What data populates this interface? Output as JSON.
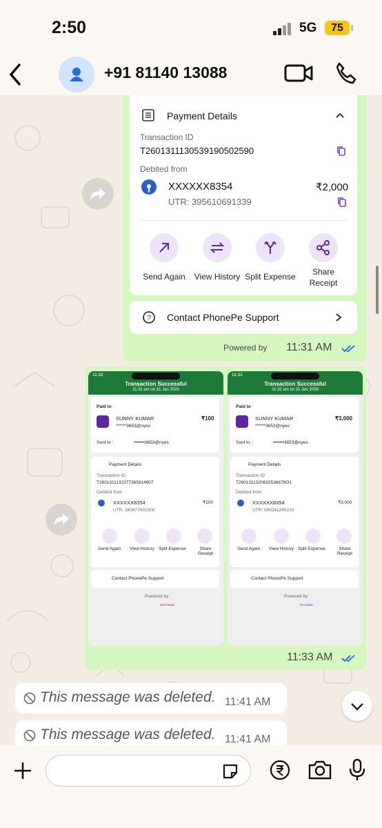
{
  "status": {
    "time": "2:50",
    "network": "5G",
    "battery": "75"
  },
  "chat": {
    "contact": "+91 81140 13088"
  },
  "msg1": {
    "section_title": "Payment Details",
    "txn_label": "Transaction ID",
    "txn_id": "T2601311130539190502590",
    "debited_label": "Debited from",
    "account": "XXXXXX8354",
    "amount": "₹2,000",
    "utr": "UTR: 395610691339",
    "actions": [
      "Send Again",
      "View History",
      "Split Expense",
      "Share\nReceipt"
    ],
    "support": "Contact PhonePe Support",
    "powered": "Powered by",
    "time": "11:31 AM"
  },
  "msg2": {
    "time": "11:33 AM",
    "shots": [
      {
        "clock": "11:32",
        "title": "Transaction Successful",
        "subtitle": "11:32 am on 31 Jan 2026",
        "paid_to": "Paid to",
        "name": "SUNNY KUMAR",
        "amount": "₹100",
        "upi": "******3653@nyes",
        "sent_to": "Sent to :",
        "sent_upi": "•••••••3653@nyes",
        "section": "Payment Details",
        "txn_label": "Transaction ID",
        "txn_id": "T2601311132377365914907",
        "debited": "Debited from",
        "account": "XXXXXX8354",
        "acct_amount": "₹100",
        "utr": "UTR: 360877650306",
        "actions": [
          "Send Again",
          "View History",
          "Split Expense",
          "Share Receipt"
        ],
        "support": "Contact PhonePe Support",
        "powered": "Powered by",
        "bank": "AXIS BANK"
      },
      {
        "clock": "11:32",
        "title": "Transaction Successful",
        "subtitle": "11:32 am on 31 Jan 2026",
        "paid_to": "Paid to",
        "name": "SUNNY KUMAR",
        "amount": "₹3,000",
        "upi": "******3653@nyes",
        "sent_to": "Sent to :",
        "sent_upi": "•••••••3653@nyes",
        "section": "Payment Details",
        "txn_label": "Transaction ID",
        "txn_id": "T2601311320632536678O1",
        "debited": "Debited from",
        "account": "XXXXXX8354",
        "acct_amount": "₹3,000",
        "utr": "UTR: 586241265220",
        "actions": [
          "Send Again",
          "View History",
          "Split Expense",
          "Share Receipt"
        ],
        "support": "Contact PhonePe Support",
        "powered": "Powered by",
        "bank": "YES BANK"
      }
    ]
  },
  "deleted": [
    {
      "text": "This message was deleted.",
      "time": "11:41 AM"
    },
    {
      "text": "This message was deleted.",
      "time": "11:41 AM"
    }
  ]
}
